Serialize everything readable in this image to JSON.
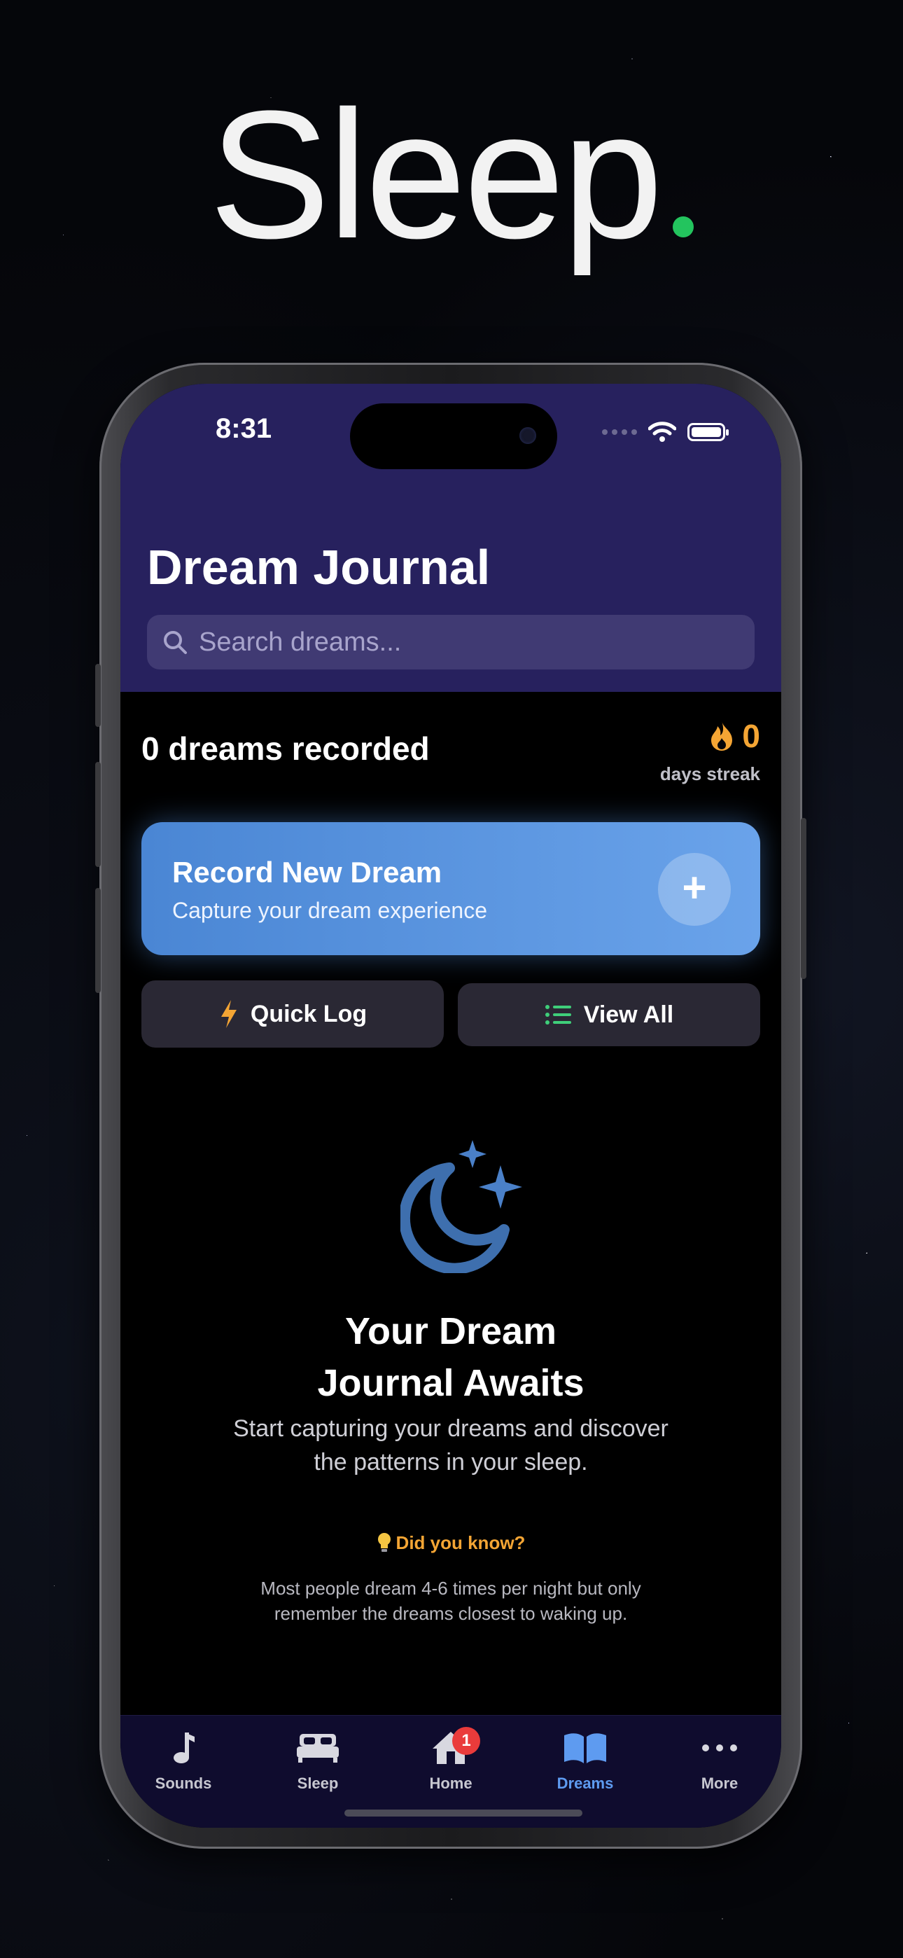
{
  "headline": {
    "text": "Sleep",
    "accent": "#23c45e"
  },
  "status_bar": {
    "time": "8:31"
  },
  "header": {
    "title": "Dream Journal",
    "search_placeholder": "Search dreams..."
  },
  "stats": {
    "count_text": "0 dreams recorded",
    "streak_value": "0",
    "streak_label": "days streak",
    "streak_color": "#f4a534"
  },
  "record_card": {
    "title": "Record New Dream",
    "subtitle": "Capture your dream experience",
    "action_icon": "plus-icon",
    "colors": [
      "#4a86d4",
      "#6aa3ea"
    ]
  },
  "actions": {
    "quick_log": {
      "label": "Quick Log",
      "icon": "lightning-icon"
    },
    "view_all": {
      "label": "View All",
      "icon": "list-icon"
    }
  },
  "empty_state": {
    "icon": "moon-stars-icon",
    "title_line1": "Your Dream",
    "title_line2": "Journal Awaits",
    "subtitle_line1": "Start capturing your dreams and discover",
    "subtitle_line2": "the patterns in your sleep.",
    "did_you_know": "Did you know?",
    "fact_line1": "Most people dream 4-6 times per night but only",
    "fact_line2": "remember the dreams closest to waking up."
  },
  "tab_bar": {
    "tabs": [
      {
        "label": "Sounds",
        "icon": "music-note-icon"
      },
      {
        "label": "Sleep",
        "icon": "bed-icon"
      },
      {
        "label": "Home",
        "icon": "house-icon",
        "badge": "1"
      },
      {
        "label": "Dreams",
        "icon": "book-icon",
        "active": true
      },
      {
        "label": "More",
        "icon": "ellipsis-icon"
      }
    ],
    "active_color": "#5e9bf0"
  }
}
